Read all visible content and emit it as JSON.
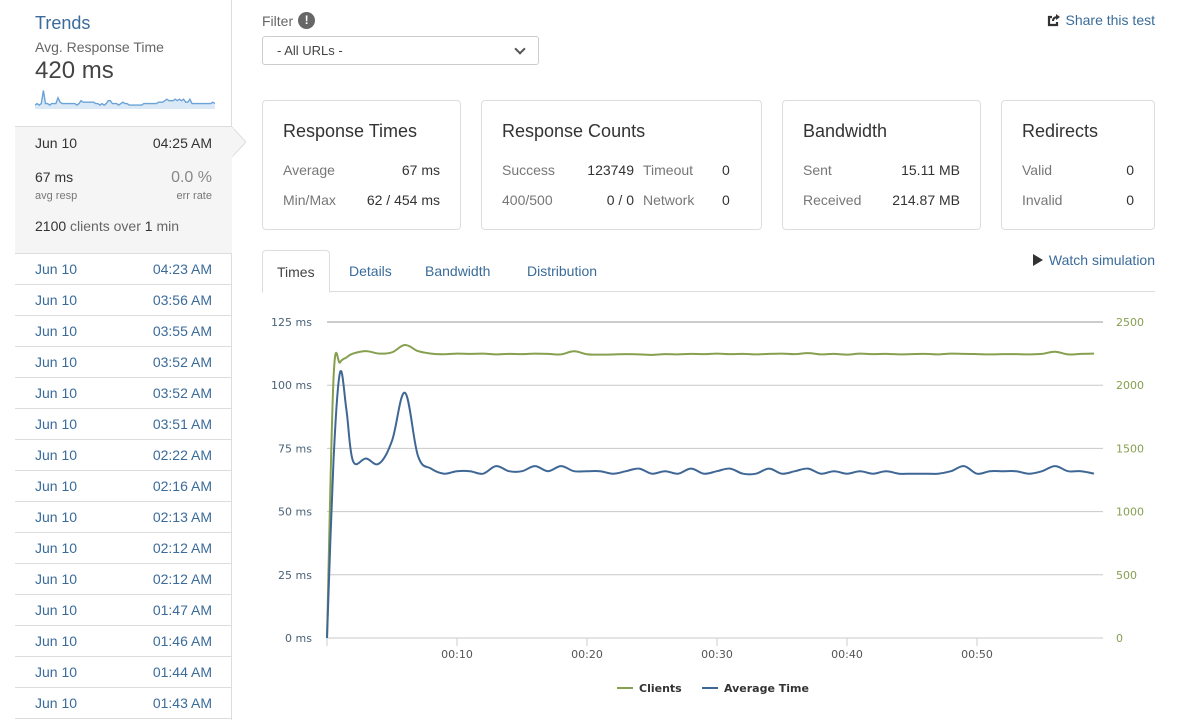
{
  "sidebar": {
    "trends_title": "Trends",
    "trends_subtitle": "Avg. Response Time",
    "trends_value": "420 ms",
    "sparkline": [
      2,
      3,
      2,
      3,
      12,
      3,
      3,
      2,
      3,
      3,
      3,
      7,
      4,
      3,
      3,
      3,
      3,
      3,
      3,
      3,
      2,
      3,
      5,
      4,
      4,
      4,
      4,
      4,
      4,
      3,
      3,
      2,
      3,
      2,
      3,
      5,
      5,
      3,
      3,
      3,
      2,
      3,
      4,
      3,
      3,
      2,
      2,
      2,
      2,
      2,
      2,
      2,
      3,
      3,
      3,
      3,
      3,
      3,
      3,
      4,
      4,
      4,
      5,
      6,
      5,
      5,
      5,
      6,
      5,
      6,
      5,
      6,
      4,
      4,
      6,
      3,
      3,
      3,
      3,
      3,
      3,
      3,
      3,
      3,
      3,
      4,
      3
    ],
    "selected_run": {
      "date": "Jun 10",
      "time": "04:25 AM",
      "avg_resp_value": "67 ms",
      "avg_resp_label": "avg resp",
      "err_rate_value": "0.0 %",
      "err_rate_label": "err rate",
      "clients_count": "2100",
      "clients_text": "clients over",
      "duration_value": "1",
      "duration_unit": "min"
    },
    "runs": [
      {
        "date": "Jun 10",
        "time": "04:23 AM"
      },
      {
        "date": "Jun 10",
        "time": "03:56 AM"
      },
      {
        "date": "Jun 10",
        "time": "03:55 AM"
      },
      {
        "date": "Jun 10",
        "time": "03:52 AM"
      },
      {
        "date": "Jun 10",
        "time": "03:52 AM"
      },
      {
        "date": "Jun 10",
        "time": "03:51 AM"
      },
      {
        "date": "Jun 10",
        "time": "02:22 AM"
      },
      {
        "date": "Jun 10",
        "time": "02:16 AM"
      },
      {
        "date": "Jun 10",
        "time": "02:13 AM"
      },
      {
        "date": "Jun 10",
        "time": "02:12 AM"
      },
      {
        "date": "Jun 10",
        "time": "02:12 AM"
      },
      {
        "date": "Jun 10",
        "time": "01:47 AM"
      },
      {
        "date": "Jun 10",
        "time": "01:46 AM"
      },
      {
        "date": "Jun 10",
        "time": "01:44 AM"
      },
      {
        "date": "Jun 10",
        "time": "01:43 AM"
      }
    ]
  },
  "filter": {
    "label": "Filter",
    "info_icon": "!",
    "selected": "- All URLs -"
  },
  "share_label": "Share this test",
  "cards": {
    "response_times": {
      "title": "Response Times",
      "average_label": "Average",
      "average_value": "67 ms",
      "minmax_label": "Min/Max",
      "minmax_value": "62 / 454 ms"
    },
    "response_counts": {
      "title": "Response Counts",
      "success_label": "Success",
      "success_value": "123749",
      "timeout_label": "Timeout",
      "timeout_value": "0",
      "errors_label": "400/500",
      "errors_value": "0 / 0",
      "network_label": "Network",
      "network_value": "0"
    },
    "bandwidth": {
      "title": "Bandwidth",
      "sent_label": "Sent",
      "sent_value": "15.11 MB",
      "received_label": "Received",
      "received_value": "214.87 MB"
    },
    "redirects": {
      "title": "Redirects",
      "valid_label": "Valid",
      "valid_value": "0",
      "invalid_label": "Invalid",
      "invalid_value": "0"
    }
  },
  "tabs": [
    {
      "label": "Times",
      "active": true
    },
    {
      "label": "Details",
      "active": false
    },
    {
      "label": "Bandwidth",
      "active": false
    },
    {
      "label": "Distribution",
      "active": false
    }
  ],
  "watch_label": "Watch simulation",
  "colors": {
    "link": "#3a6b9a",
    "clients": "#86a050",
    "avg_time": "#3f6795",
    "grid": "#c8c8c8",
    "left_axis_text": "#4a6278",
    "right_axis_text": "#86a050"
  },
  "chart_data": {
    "type": "line",
    "title": "",
    "xlabel": "",
    "x_unit": "minutes",
    "x_range": [
      0,
      59
    ],
    "x_ticks": [
      10,
      20,
      30,
      40,
      50
    ],
    "x_tick_labels": [
      "00:10",
      "00:20",
      "00:30",
      "00:40",
      "00:50"
    ],
    "y_left": {
      "label": "",
      "range": [
        0,
        125
      ],
      "ticks": [
        0,
        25,
        50,
        75,
        100,
        125
      ],
      "tick_labels": [
        "0 ms",
        "25 ms",
        "50 ms",
        "75 ms",
        "100 ms",
        "125 ms"
      ]
    },
    "y_right": {
      "label": "",
      "range": [
        0,
        2500
      ],
      "ticks": [
        0,
        500,
        1000,
        1500,
        2000,
        2500
      ],
      "tick_labels": [
        "0",
        "500",
        "1000",
        "1500",
        "2000",
        "2500"
      ]
    },
    "grid": true,
    "legend_position": "bottom",
    "x": [
      0,
      0.5,
      1,
      1.5,
      2,
      3,
      4,
      5,
      6,
      7,
      8,
      9,
      10,
      11,
      12,
      13,
      14,
      15,
      16,
      17,
      18,
      19,
      20,
      21,
      22,
      23,
      24,
      25,
      26,
      27,
      28,
      29,
      30,
      31,
      32,
      33,
      34,
      35,
      36,
      37,
      38,
      39,
      40,
      41,
      42,
      43,
      44,
      45,
      46,
      47,
      48,
      49,
      50,
      51,
      52,
      53,
      54,
      55,
      56,
      57,
      58,
      59
    ],
    "series": [
      {
        "name": "Clients",
        "axis": "right",
        "values": [
          0,
          2050,
          2180,
          2220,
          2250,
          2270,
          2250,
          2260,
          2318,
          2270,
          2250,
          2245,
          2250,
          2248,
          2250,
          2244,
          2248,
          2246,
          2250,
          2248,
          2244,
          2268,
          2245,
          2242,
          2243,
          2246,
          2244,
          2240,
          2246,
          2244,
          2248,
          2246,
          2250,
          2246,
          2248,
          2244,
          2248,
          2250,
          2246,
          2254,
          2244,
          2248,
          2242,
          2250,
          2246,
          2248,
          2244,
          2246,
          2248,
          2244,
          2250,
          2248,
          2246,
          2244,
          2246,
          2246,
          2244,
          2248,
          2265,
          2244,
          2248,
          2250
        ]
      },
      {
        "name": "Average Time",
        "axis": "left",
        "values": [
          0,
          70,
          105,
          90,
          70,
          71,
          69,
          78,
          97,
          72,
          67,
          65,
          66,
          66,
          65,
          68,
          66,
          66,
          68,
          66,
          68,
          66,
          66,
          66,
          65,
          66,
          67,
          65,
          66,
          65,
          67,
          65,
          66,
          67,
          65,
          65,
          67,
          65,
          66,
          67,
          65,
          66,
          65,
          66,
          65,
          66,
          65,
          65,
          65,
          65,
          66,
          68,
          65,
          66,
          66,
          66,
          65,
          66,
          68,
          66,
          66,
          65
        ]
      }
    ]
  }
}
